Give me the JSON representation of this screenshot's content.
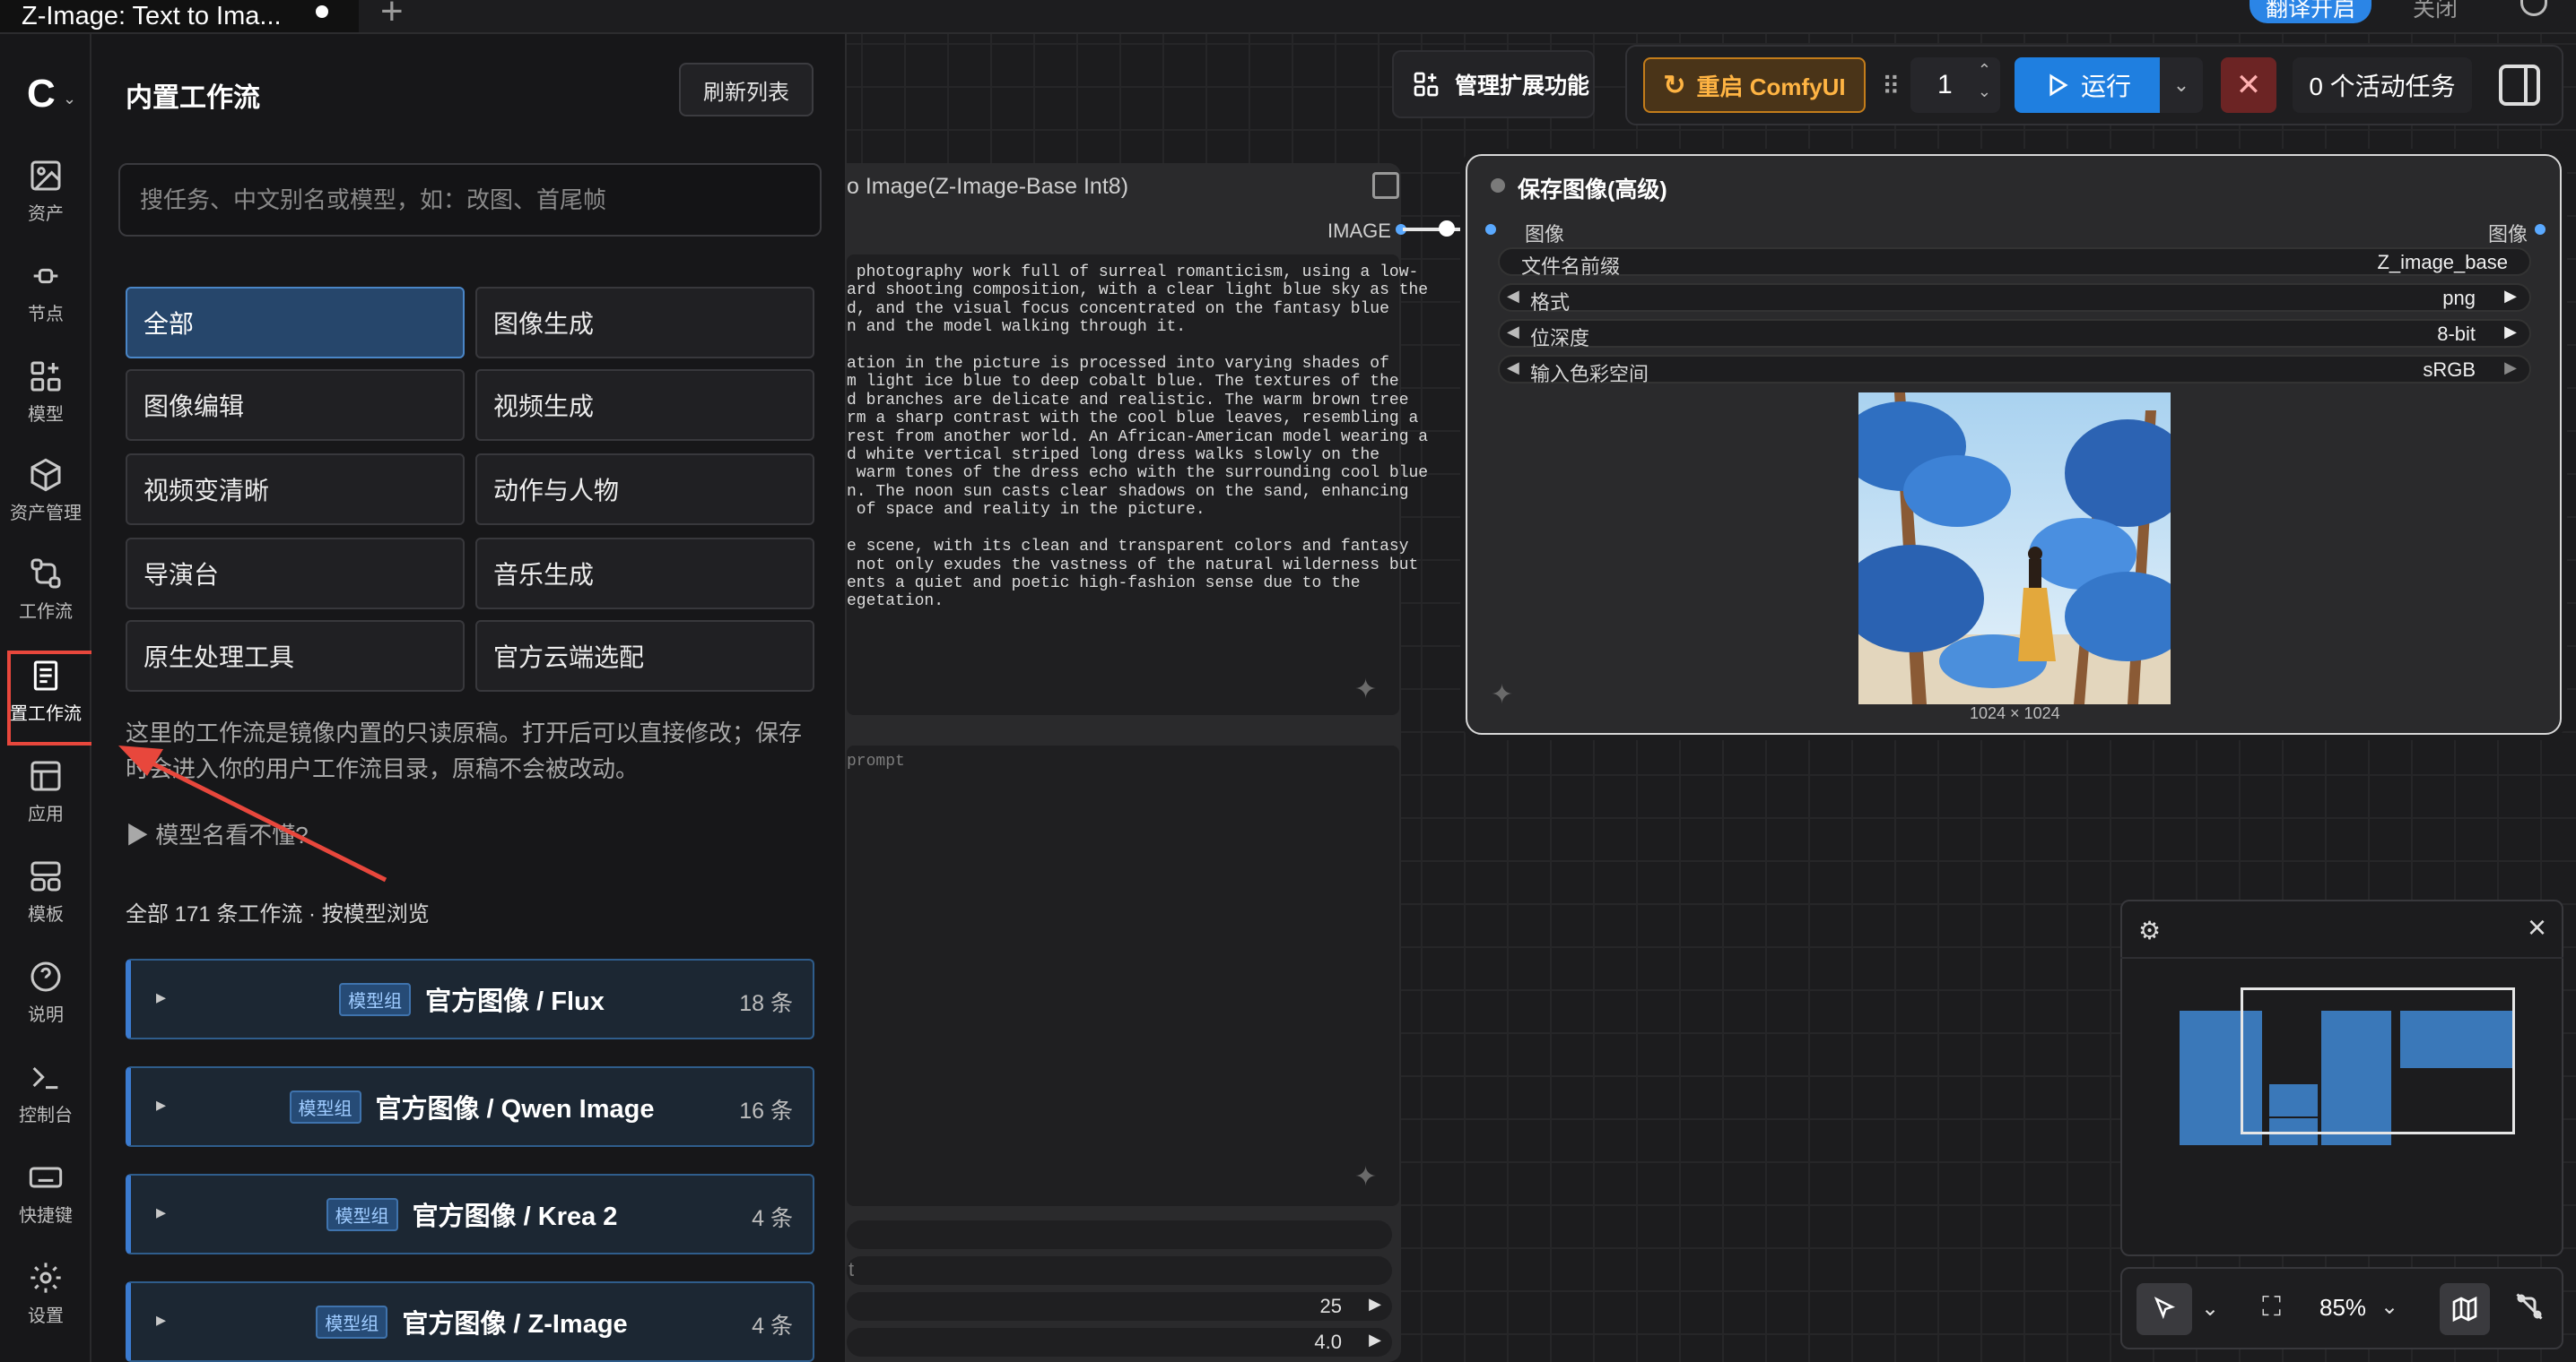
{
  "tab": {
    "title": "Z-Image: Text to Ima..."
  },
  "topbar": {
    "translate": "翻译开启",
    "close": "关闭"
  },
  "rail": {
    "items": [
      {
        "label": "资产",
        "icon": "image-icon"
      },
      {
        "label": "节点",
        "icon": "node-icon"
      },
      {
        "label": "模型",
        "icon": "model-icon"
      },
      {
        "label": "资产管理",
        "icon": "box-icon"
      },
      {
        "label": "工作流",
        "icon": "workflow-icon"
      },
      {
        "label": "置工作流",
        "icon": "document-icon"
      },
      {
        "label": "应用",
        "icon": "app-icon"
      },
      {
        "label": "模板",
        "icon": "template-icon"
      },
      {
        "label": "说明",
        "icon": "help-icon"
      },
      {
        "label": "控制台",
        "icon": "terminal-icon"
      },
      {
        "label": "快捷键",
        "icon": "keyboard-icon"
      },
      {
        "label": "设置",
        "icon": "gear-icon"
      }
    ]
  },
  "panel": {
    "title": "内置工作流",
    "refresh": "刷新列表",
    "search_placeholder": "搜任务、中文别名或模型，如：改图、首尾帧",
    "categories": [
      "全部",
      "图像生成",
      "图像编辑",
      "视频生成",
      "视频变清晰",
      "动作与人物",
      "导演台",
      "音乐生成",
      "原生处理工具",
      "官方云端选配"
    ],
    "note": "这里的工作流是镜像内置的只读原稿。打开后可以直接修改；保存时会进入你的用户工作流目录，原稿不会被改动。",
    "model_question": "▶ 模型名看不懂?",
    "count_line": "全部 171 条工作流 · 按模型浏览",
    "badge": "模型组",
    "groups": [
      {
        "name": "官方图像 / Flux",
        "count": "18 条"
      },
      {
        "name": "官方图像 / Qwen Image",
        "count": "16 条"
      },
      {
        "name": "官方图像 / Krea 2",
        "count": "4 条"
      },
      {
        "name": "官方图像 / Z-Image",
        "count": "4 条"
      }
    ]
  },
  "node_left": {
    "title": "o Image(Z-Image-Base Int8)",
    "output": "IMAGE",
    "prompt": " photography work full of surreal romanticism, using a low-\nard shooting composition, with a clear light blue sky as the\nd, and the visual focus concentrated on the fantasy blue\nn and the model walking through it.\n\nation in the picture is processed into varying shades of\nm light ice blue to deep cobalt blue. The textures of the\nd branches are delicate and realistic. The warm brown tree\nrm a sharp contrast with the cool blue leaves, resembling a\nrest from another world. An African-American model wearing a\nd white vertical striped long dress walks slowly on the\n warm tones of the dress echo with the surrounding cool blue\nn. The noon sun casts clear shadows on the sand, enhancing\n of space and reality in the picture.\n\ne scene, with its clean and transparent colors and fantasy\n not only exudes the vastness of the natural wilderness but\nents a quiet and poetic high-fashion sense due to the\negetation.",
    "negative": "prompt",
    "row_t": "t",
    "steps": "25",
    "cfg": "4.0"
  },
  "save_node": {
    "title": "保存图像(高级)",
    "input": "图像",
    "output": "图像",
    "widgets": [
      {
        "label": "文件名前缀",
        "value": "Z_image_base"
      },
      {
        "label": "格式",
        "value": "png"
      },
      {
        "label": "位深度",
        "value": "8-bit"
      },
      {
        "label": "输入色彩空间",
        "value": "sRGB"
      }
    ],
    "dimensions": "1024 × 1024"
  },
  "toolbar": {
    "extensions": "管理扩展功能",
    "restart": "重启 ComfyUI",
    "quantity": "1",
    "run": "运行",
    "tasks": "0 个活动任务"
  },
  "canvas_tools": {
    "zoom": "85%"
  }
}
